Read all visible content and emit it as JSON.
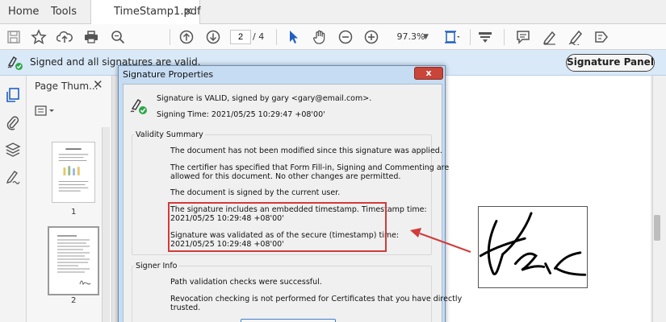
{
  "tabs": {
    "home": "Home",
    "tools": "Tools",
    "document": "TimeStamp1.pdf",
    "close_glyph": "✕"
  },
  "toolbar": {
    "page_current": "2",
    "page_of": "/  4",
    "zoom": "97.3%"
  },
  "signature_bar": {
    "message": "Signed and all signatures are valid.",
    "panel_button": "Signature Panel"
  },
  "thumbnails": {
    "title": "Page Thum...",
    "close_glyph": "✕",
    "pages": [
      "1",
      "2"
    ]
  },
  "dialog": {
    "title": "Signature Properties",
    "close_glyph": "x",
    "status_line": "Signature is VALID, signed by gary <gary@email.com>.",
    "signing_time": "Signing Time:  2021/05/25 10:29:47 +08'00'",
    "validity_summary": {
      "label": "Validity Summary",
      "lines": [
        "The document has not been modified since this signature was applied.",
        "The certifier has specified that Form Fill-in, Signing and Commenting are",
        "allowed for this document. No other changes are permitted.",
        "The document is signed by the current user.",
        "The signature includes an embedded timestamp. Timestamp time:",
        "2021/05/25 10:29:48 +08'00'",
        "Signature was validated as of the secure (timestamp) time:",
        "2021/05/25 10:29:48 +08'00'"
      ]
    },
    "signer_info": {
      "label": "Signer Info",
      "lines": [
        "Path validation checks were successful.",
        "Revocation checking is not performed for Certificates that you have directly",
        "trusted."
      ]
    }
  },
  "colors": {
    "sig_bar_bg": "#d9e9f8",
    "highlight": "#d23b3b",
    "dialog_frame": "#c6dcf2"
  }
}
